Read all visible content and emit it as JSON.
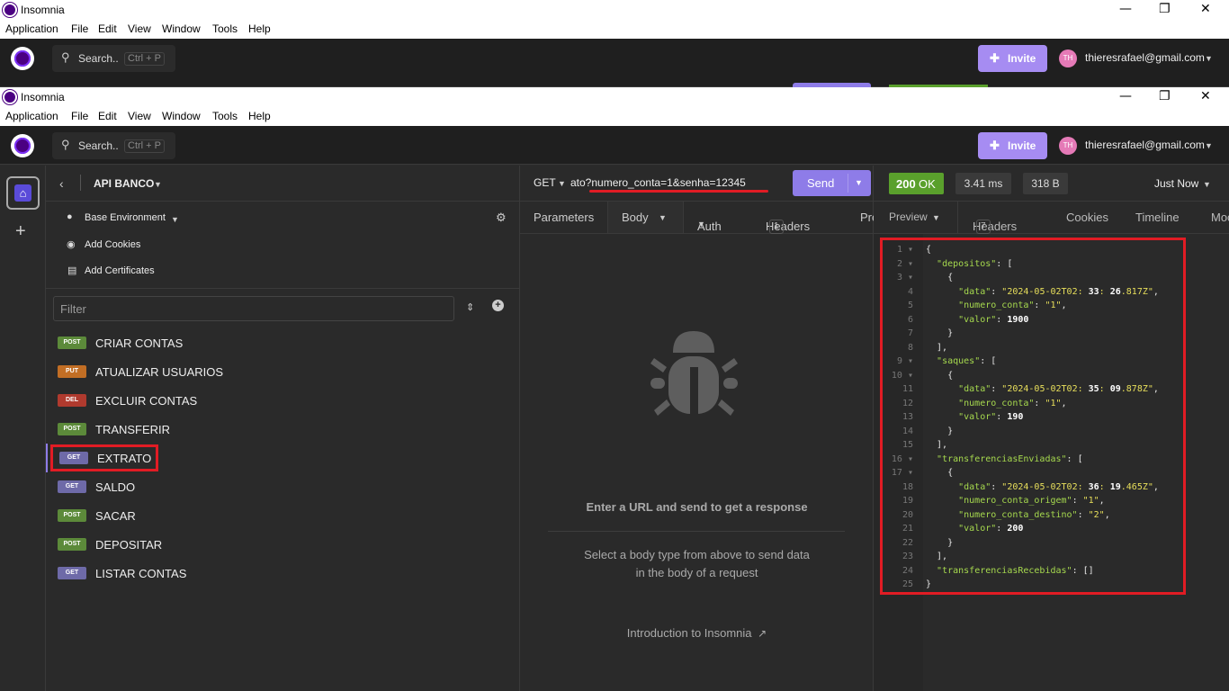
{
  "bg_window": {
    "title": "Insomnia",
    "menu": [
      "Application",
      "File",
      "Edit",
      "View",
      "Window",
      "Tools",
      "Help"
    ],
    "search_label": "Search..",
    "search_shortcut": "Ctrl + P",
    "invite_label": "Invite",
    "avatar_initials": "TH",
    "email": "thieresrafael@gmail.com"
  },
  "window": {
    "title": "Insomnia",
    "menu": [
      "Application",
      "File",
      "Edit",
      "View",
      "Window",
      "Tools",
      "Help"
    ],
    "minimize": "—",
    "maximize": "❐",
    "close": "✕"
  },
  "topbar": {
    "search_label": "Search..",
    "search_shortcut": "Ctrl + P",
    "invite_label": "Invite",
    "avatar_initials": "TH",
    "email": "thieresrafael@gmail.com"
  },
  "sidebar": {
    "project": "API BANCO",
    "environment": "Base Environment",
    "add_cookies": "Add Cookies",
    "add_certificates": "Add Certificates",
    "filter_placeholder": "Filter",
    "requests": [
      {
        "method": "POST",
        "name": "CRIAR CONTAS"
      },
      {
        "method": "PUT",
        "name": "ATUALIZAR USUARIOS"
      },
      {
        "method": "DEL",
        "name": "EXCLUIR CONTAS"
      },
      {
        "method": "POST",
        "name": "TRANSFERIR"
      },
      {
        "method": "GET",
        "name": "EXTRATO"
      },
      {
        "method": "GET",
        "name": "SALDO"
      },
      {
        "method": "POST",
        "name": "SACAR"
      },
      {
        "method": "POST",
        "name": "DEPOSITAR"
      },
      {
        "method": "GET",
        "name": "LISTAR CONTAS"
      }
    ]
  },
  "request": {
    "method": "GET",
    "url_visible": "ato?numero_conta=1&senha=12345",
    "send_label": "Send",
    "tabs": [
      "Parameters",
      "Body",
      "Auth",
      "Headers",
      "Pre"
    ],
    "headers_count": "1",
    "empty_title": "Enter a URL and send to get a response",
    "empty_desc_line1": "Select a body type from above to send data",
    "empty_desc_line2": "in the body of a request",
    "intro_link": "Introduction to Insomnia"
  },
  "response": {
    "status": "200",
    "status_text": "OK",
    "time": "3.41 ms",
    "size": "318 B",
    "when": "Just Now",
    "tabs": [
      "Preview",
      "Headers",
      "Cookies",
      "Timeline",
      "Moc"
    ],
    "headers_count": "7",
    "lines": [
      "{",
      "  \"depositos\": [",
      "    {",
      "      \"data\": \"2024-05-02T02:33:26.817Z\",",
      "      \"numero_conta\": \"1\",",
      "      \"valor\": 1900",
      "    }",
      "  ],",
      "  \"saques\": [",
      "    {",
      "      \"data\": \"2024-05-02T02:35:09.878Z\",",
      "      \"numero_conta\": \"1\",",
      "      \"valor\": 190",
      "    }",
      "  ],",
      "  \"transferenciasEnviadas\": [",
      "    {",
      "      \"data\": \"2024-05-02T02:36:19.465Z\",",
      "      \"numero_conta_origem\": \"1\",",
      "      \"numero_conta_destino\": \"2\",",
      "      \"valor\": 200",
      "    }",
      "  ],",
      "  \"transferenciasRecebidas\": []",
      "}"
    ]
  }
}
